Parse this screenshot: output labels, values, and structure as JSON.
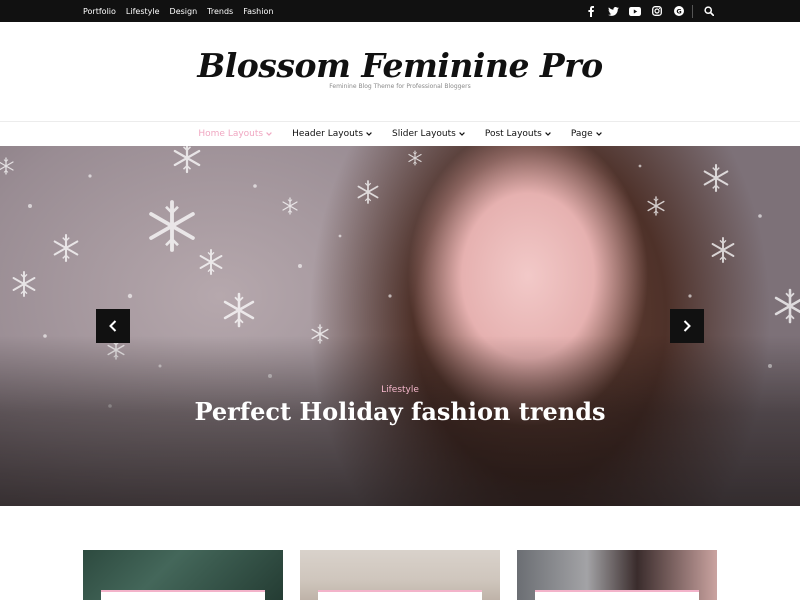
{
  "topbar": {
    "menu": [
      "Portfolio",
      "Lifestyle",
      "Design",
      "Trends",
      "Fashion"
    ],
    "social_icons": [
      "facebook-icon",
      "twitter-icon",
      "youtube-icon",
      "instagram-icon",
      "google-plus-icon"
    ],
    "search_icon": "search-icon"
  },
  "header": {
    "title": "Blossom Feminine Pro",
    "tagline": "Feminine Blog Theme for Professional Bloggers"
  },
  "nav": {
    "items": [
      {
        "label": "Home Layouts",
        "active": true
      },
      {
        "label": "Header Layouts",
        "active": false
      },
      {
        "label": "Slider Layouts",
        "active": false
      },
      {
        "label": "Post Layouts",
        "active": false
      },
      {
        "label": "Page",
        "active": false
      }
    ]
  },
  "slider": {
    "category": "Lifestyle",
    "title": "Perfect Holiday fashion trends",
    "prev_icon": "chevron-left-icon",
    "next_icon": "chevron-right-icon"
  },
  "colors": {
    "accent": "#f0a8c2",
    "topbar": "#111111",
    "text": "#111111"
  }
}
